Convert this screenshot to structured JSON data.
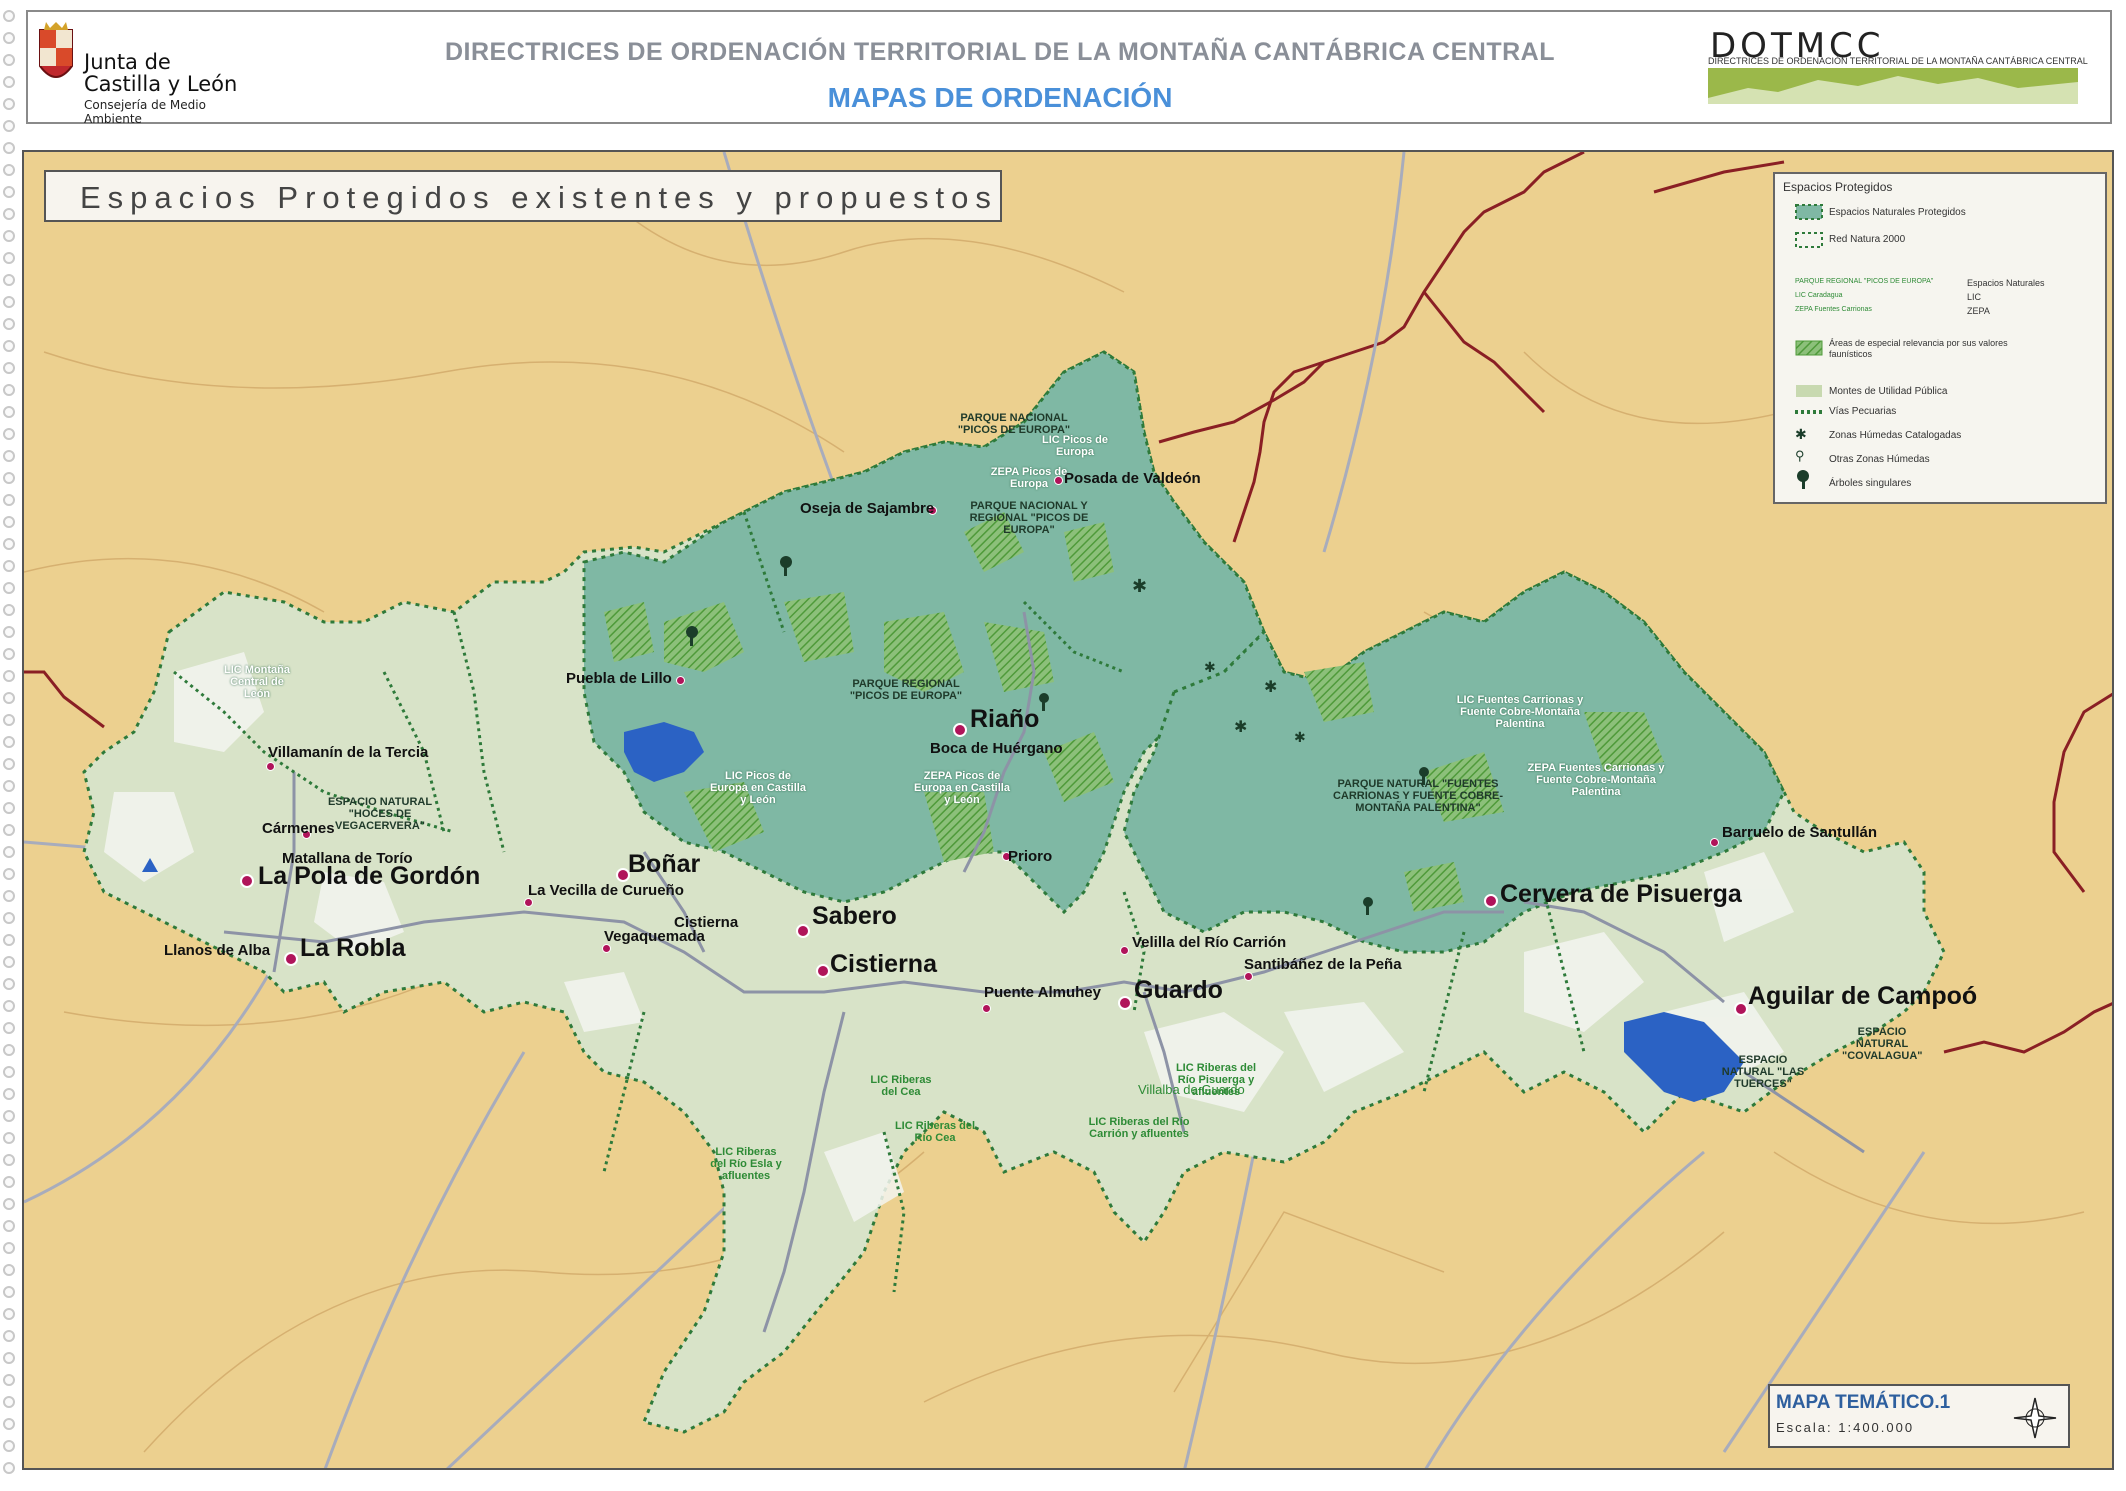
{
  "header": {
    "org_line1": "Junta de",
    "org_line2": "Castilla y León",
    "org_dept": "Consejería de Medio Ambiente",
    "title": "DIRECTRICES DE ORDENACIÓN TERRITORIAL DE LA MONTAÑA CANTÁBRICA CENTRAL",
    "subtitle": "MAPAS DE ORDENACIÓN",
    "brand": "DOTMCC",
    "brand_sub": "DIRECTRICES DE ORDENACIÓN TERRITORIAL DE LA MONTAÑA CANTÁBRICA CENTRAL"
  },
  "map_title": "Espacios Protegidos existentes y propuestos",
  "legend": {
    "title": "Espacios Protegidos",
    "items": [
      {
        "label": "Espacios Naturales Protegidos",
        "icon": "dashed-green-box"
      },
      {
        "label": "Red Natura 2000",
        "icon": "dashed-green-box"
      },
      {
        "label": "PARQUE REGIONAL \"PICOS DE EUROPA\"",
        "value": "Espacios Naturales",
        "icon": "text-sample"
      },
      {
        "label": "LIC Caradagua",
        "value": "LIC",
        "icon": "text-sample"
      },
      {
        "label": "ZEPA Fuentes Carrionas",
        "value": "ZEPA",
        "icon": "text-sample"
      },
      {
        "label": "Áreas de especial relevancia por sus valores faunísticos",
        "icon": "hatched-green"
      },
      {
        "label": "Montes de Utilidad Pública",
        "icon": "light-green-fill"
      },
      {
        "label": "Vías Pecuarias",
        "icon": "dotted-green-line"
      },
      {
        "label": "Zonas Húmedas Catalogadas",
        "icon": "marsh-icon"
      },
      {
        "label": "Otras Zonas Húmedas",
        "icon": "marsh-small-icon"
      },
      {
        "label": "Árboles singulares",
        "icon": "tree-icon"
      }
    ]
  },
  "towns_major": [
    {
      "name": "Riaño"
    },
    {
      "name": "La Pola de Gordón"
    },
    {
      "name": "La Robla"
    },
    {
      "name": "Boñar"
    },
    {
      "name": "Sabero"
    },
    {
      "name": "Cistierna"
    },
    {
      "name": "Guardo"
    },
    {
      "name": "Cervera de Pisuerga"
    },
    {
      "name": "Aguilar de Campoó"
    }
  ],
  "towns_minor": [
    {
      "name": "Posada de Valdeón"
    },
    {
      "name": "Oseja de Sajambre"
    },
    {
      "name": "Puebla de Lillo"
    },
    {
      "name": "Boca de Huérgano"
    },
    {
      "name": "Villamanín de la Tercia"
    },
    {
      "name": "Cármenes"
    },
    {
      "name": "Matallana de Torío"
    },
    {
      "name": "La Vecilla de Curueño"
    },
    {
      "name": "Vegaquemada"
    },
    {
      "name": "Cistierna"
    },
    {
      "name": "Llanos de Alba"
    },
    {
      "name": "Prioro"
    },
    {
      "name": "Velilla del Río Carrión"
    },
    {
      "name": "Santibáñez de la Peña"
    },
    {
      "name": "Puente Almuhey"
    },
    {
      "name": "Villalba de Guardo"
    },
    {
      "name": "Barruelo de Santullán"
    }
  ],
  "protected_labels": {
    "pn_picos": "PARQUE NACIONAL \"PICOS DE EUROPA\"",
    "lic_picos": "LIC Picos de Europa",
    "zepa_picos": "ZEPA Picos de Europa",
    "pnr_picos": "PARQUE NACIONAL Y REGIONAL \"PICOS DE EUROPA\"",
    "pr_picos": "PARQUE REGIONAL \"PICOS DE EUROPA\"",
    "lic_picos_cyl": "LIC Picos de Europa en Castilla y León",
    "zepa_picos_cyl": "ZEPA Picos de Europa en Castilla y León",
    "lic_montana": "LIC Montaña Central de León",
    "en_vegacervera": "ESPACIO NATURAL \"HOCES DE VEGACERVERA\"",
    "lic_fuentes": "LIC Fuentes Carrionas y Fuente Cobre-Montaña Palentina",
    "pn_fuentes": "PARQUE NATURAL \"FUENTES CARRIONAS Y FUENTE COBRE-MONTAÑA PALENTINA\"",
    "zepa_fuentes": "ZEPA Fuentes Carrionas y Fuente Cobre-Montaña Palentina",
    "lic_riberas_esla": "LIC Riberas del Río Esla y afluentes",
    "lic_riberas_cea": "LIC Riberas del Cea",
    "lic_riberas_cea2": "LIC Riberas del Río Cea",
    "lic_riberas_carrion": "LIC Riberas del Río Carrión y afluentes",
    "lic_riberas_pisuerga": "LIC Riberas del Río Pisuerga y afluentes",
    "en_tuerces": "ESPACIO NATURAL \"LAS TUERCES\"",
    "en_covalagua": "ESPACIO NATURAL \"COVALAGUA\""
  },
  "footer": {
    "map_id": "MAPA TEMÁTICO.1",
    "scale": "Escala: 1:400.000"
  },
  "colors": {
    "background_land": "#e9cb8a",
    "region_light": "#cbd9b8",
    "protected": "#7fb8a4",
    "boundary": "#8a1f24",
    "roads": "#8f95a8",
    "town": "#b0145a",
    "reservoir": "#2b62c4"
  }
}
